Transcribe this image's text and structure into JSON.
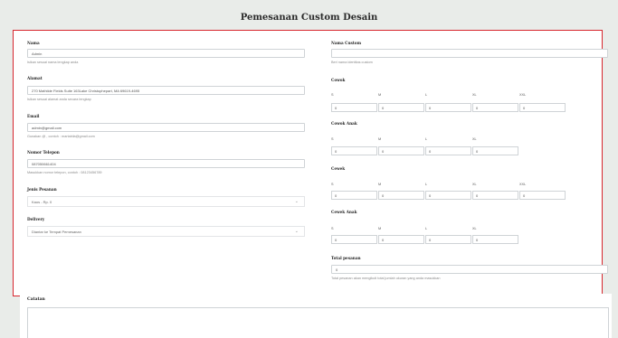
{
  "page_title": "Pemesanan Custom Desain",
  "left": {
    "nama": {
      "label": "Nama",
      "value": "Admin",
      "hint": "Isikan sesuai nama lengkap anda"
    },
    "alamat": {
      "label": "Alamat",
      "value": "270 Mathilde Fields Suite 163Lake Christophepart, MA 69619-4695",
      "hint": "Isikan sesuai alamat anda secara lengkap"
    },
    "email": {
      "label": "Email",
      "value": "admin@gmail.com",
      "hint": "Gunakan @ , contoh : martabila@gmail.com"
    },
    "telepon": {
      "label": "Nomor Telepon",
      "value": "087050661404",
      "hint": "Masukkan nomor telepon, contoh : 08123456789"
    },
    "jenis": {
      "label": "Jenis Pesanan",
      "value": "Kaos - Rp. 0"
    },
    "delivery": {
      "label": "Delivery",
      "value": "Diantar ke Tempat Pemesanan"
    }
  },
  "right": {
    "nama_custom": {
      "label": "Nama Custom",
      "value": "",
      "hint": "Beri nama identitas custom"
    },
    "groups": [
      {
        "label": "Cowok",
        "sizes": [
          "S",
          "M",
          "L",
          "XL",
          "XXL"
        ],
        "values": [
          "0",
          "0",
          "0",
          "0",
          "0"
        ]
      },
      {
        "label": "Cowok Anak",
        "sizes": [
          "S",
          "M",
          "L",
          "XL"
        ],
        "values": [
          "0",
          "0",
          "0",
          "0"
        ]
      },
      {
        "label": "Cewek",
        "sizes": [
          "S",
          "M",
          "L",
          "XL",
          "XXL"
        ],
        "values": [
          "0",
          "0",
          "0",
          "0",
          "0"
        ]
      },
      {
        "label": "Cewek Anak",
        "sizes": [
          "S",
          "M",
          "L",
          "XL"
        ],
        "values": [
          "0",
          "0",
          "0",
          "0"
        ]
      }
    ],
    "total": {
      "label": "Total pesanan",
      "value": "0",
      "hint": "Total pesanan akan mengikuti total jumlah ukuran yang anda masukkan"
    }
  },
  "notes": {
    "label": "Catatan",
    "value": ""
  },
  "icons": {
    "select_arrow": "chevron-down-icon"
  },
  "colors": {
    "highlight_border": "#d7262e",
    "background": "#e9ece9"
  }
}
